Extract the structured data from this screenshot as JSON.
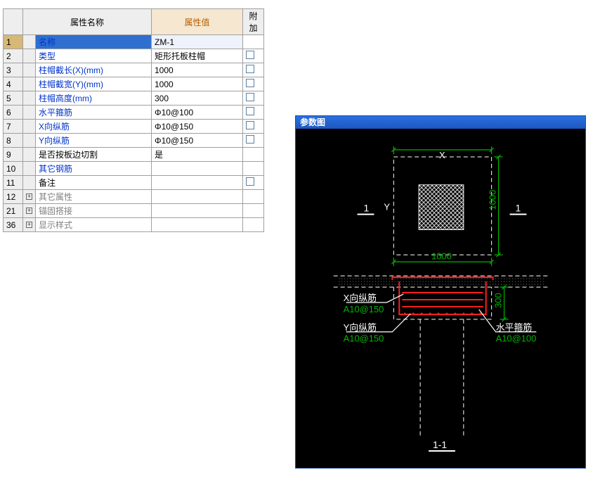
{
  "table": {
    "headers": {
      "name": "属性名称",
      "value": "属性值",
      "extra": "附加"
    },
    "rows": [
      {
        "num": "1",
        "name": "名称",
        "value": "ZM-1",
        "link": true,
        "extra": false,
        "selected": true
      },
      {
        "num": "2",
        "name": "类型",
        "value": "矩形托板柱帽",
        "link": true,
        "extra": true
      },
      {
        "num": "3",
        "name": "柱帽截长(X)(mm)",
        "value": "1000",
        "link": true,
        "extra": true
      },
      {
        "num": "4",
        "name": "柱帽截宽(Y)(mm)",
        "value": "1000",
        "link": true,
        "extra": true
      },
      {
        "num": "5",
        "name": "柱帽高度(mm)",
        "value": "300",
        "link": true,
        "extra": true
      },
      {
        "num": "6",
        "name": "水平箍筋",
        "value": "Φ10@100",
        "link": true,
        "extra": true
      },
      {
        "num": "7",
        "name": "X向纵筋",
        "value": "Φ10@150",
        "link": true,
        "extra": true
      },
      {
        "num": "8",
        "name": "Y向纵筋",
        "value": "Φ10@150",
        "link": true,
        "extra": true
      },
      {
        "num": "9",
        "name": "是否按板边切割",
        "value": "是",
        "link": false,
        "extra": false
      },
      {
        "num": "10",
        "name": "其它钢筋",
        "value": "",
        "link": true,
        "extra": false
      },
      {
        "num": "11",
        "name": "备注",
        "value": "",
        "link": false,
        "extra": true
      },
      {
        "num": "12",
        "name": "其它属性",
        "value": "",
        "link": false,
        "extra": false,
        "muted": true,
        "expand": true
      },
      {
        "num": "21",
        "name": "锚固搭接",
        "value": "",
        "link": false,
        "extra": false,
        "muted": true,
        "expand": true
      },
      {
        "num": "36",
        "name": "显示样式",
        "value": "",
        "link": false,
        "extra": false,
        "muted": true,
        "expand": true
      }
    ]
  },
  "diagram": {
    "title": "参数图",
    "labels": {
      "X": "X",
      "Y": "Y",
      "dim1000_x": "1000",
      "dim1000_y": "1000",
      "dim300": "300",
      "one_a": "1",
      "one_b": "1",
      "xrebar": "X向纵筋",
      "yrebar": "Y向纵筋",
      "hoop": "水平箍筋",
      "xval": "A10@150",
      "yval": "A10@150",
      "hval": "A10@100",
      "section": "1-1"
    }
  }
}
